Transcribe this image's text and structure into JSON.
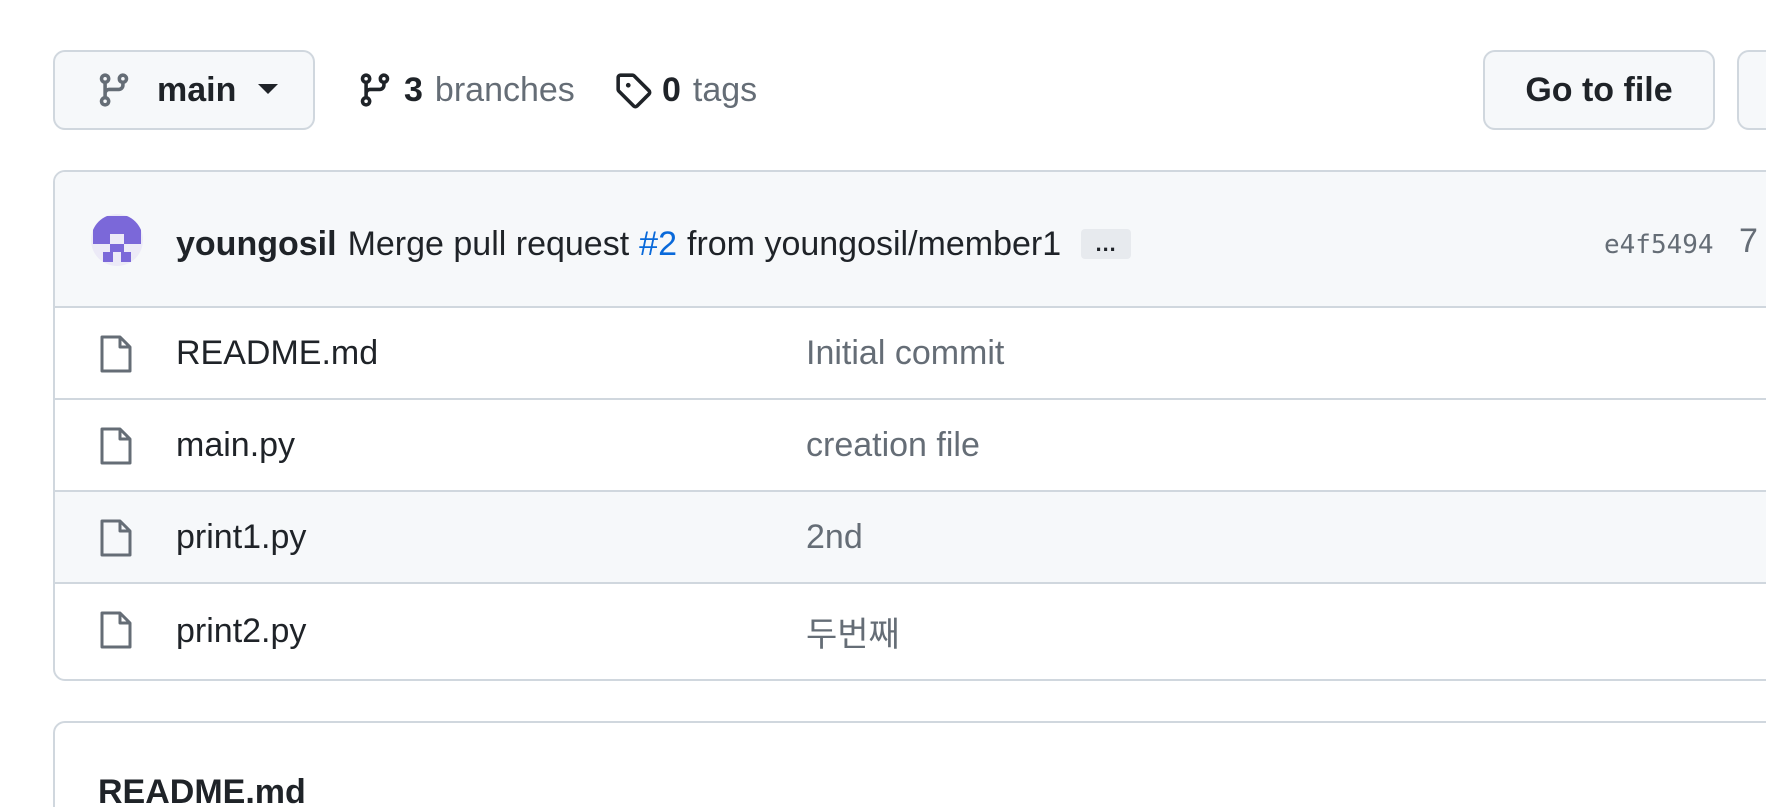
{
  "toolbar": {
    "branch_name": "main",
    "branches_count": "3",
    "branches_label": "branches",
    "tags_count": "0",
    "tags_label": "tags",
    "goto_file_label": "Go to file"
  },
  "latest_commit": {
    "author": "youngosil",
    "message_prefix": "Merge pull request",
    "pr_ref": "#2",
    "message_suffix": "from youngosil/member1",
    "ellipsis": "…",
    "sha": "e4f5494",
    "time_partial": "7"
  },
  "files": [
    {
      "name": "README.md",
      "message": "Initial commit",
      "icon": "file-icon"
    },
    {
      "name": "main.py",
      "message": "creation file",
      "icon": "file-icon"
    },
    {
      "name": "print1.py",
      "message": "2nd",
      "icon": "file-icon"
    },
    {
      "name": "print2.py",
      "message": "두번째",
      "icon": "file-icon"
    }
  ],
  "readme": {
    "title": "README.md"
  },
  "colors": {
    "border": "#d0d7de",
    "muted_text": "#656d76",
    "link": "#0969da",
    "avatar": "#7b68d9"
  }
}
